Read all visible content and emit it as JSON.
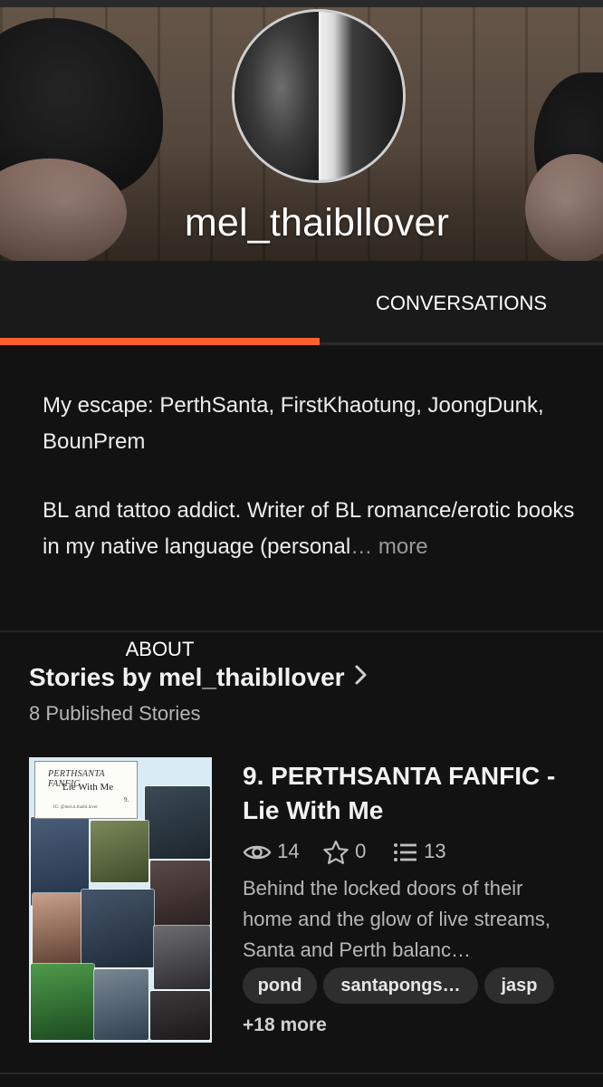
{
  "profile": {
    "username": "mel_thaibllover"
  },
  "tabs": [
    {
      "label": "ABOUT",
      "active": true
    },
    {
      "label": "CONVERSATIONS",
      "active": false
    }
  ],
  "about": {
    "line1": "My escape: PerthSanta, FirstKhaotung, JoongDunk, BounPrem",
    "line2": "BL and tattoo addict. Writer of BL romance/erotic books in my native language (personal",
    "ellipsis": "…",
    "more_label": " more"
  },
  "stories": {
    "title": "Stories by mel_thaibllover",
    "count_label": "8 Published Stories",
    "items": [
      {
        "cover": {
          "header": "PERTHSANTA FANFIC",
          "title": "Lie With Me",
          "number": "9.",
          "byline": "IG: @mel.st.thaibl.lover"
        },
        "title": "9. PERTHSANTA FANFIC - Lie With Me",
        "reads": "14",
        "votes": "0",
        "parts": "13",
        "description": "Behind the locked doors of their home and the glow of live streams, Santa and Perth balanc…",
        "tags": [
          "pond",
          "santapongs…",
          "jasp"
        ],
        "more_tags": "+18 more"
      }
    ]
  },
  "colors": {
    "accent": "#ff5f2e",
    "background": "#121212"
  },
  "icons": {
    "reads": "eye-icon",
    "votes": "star-icon",
    "parts": "list-icon",
    "chevron": "chevron-right-icon"
  }
}
